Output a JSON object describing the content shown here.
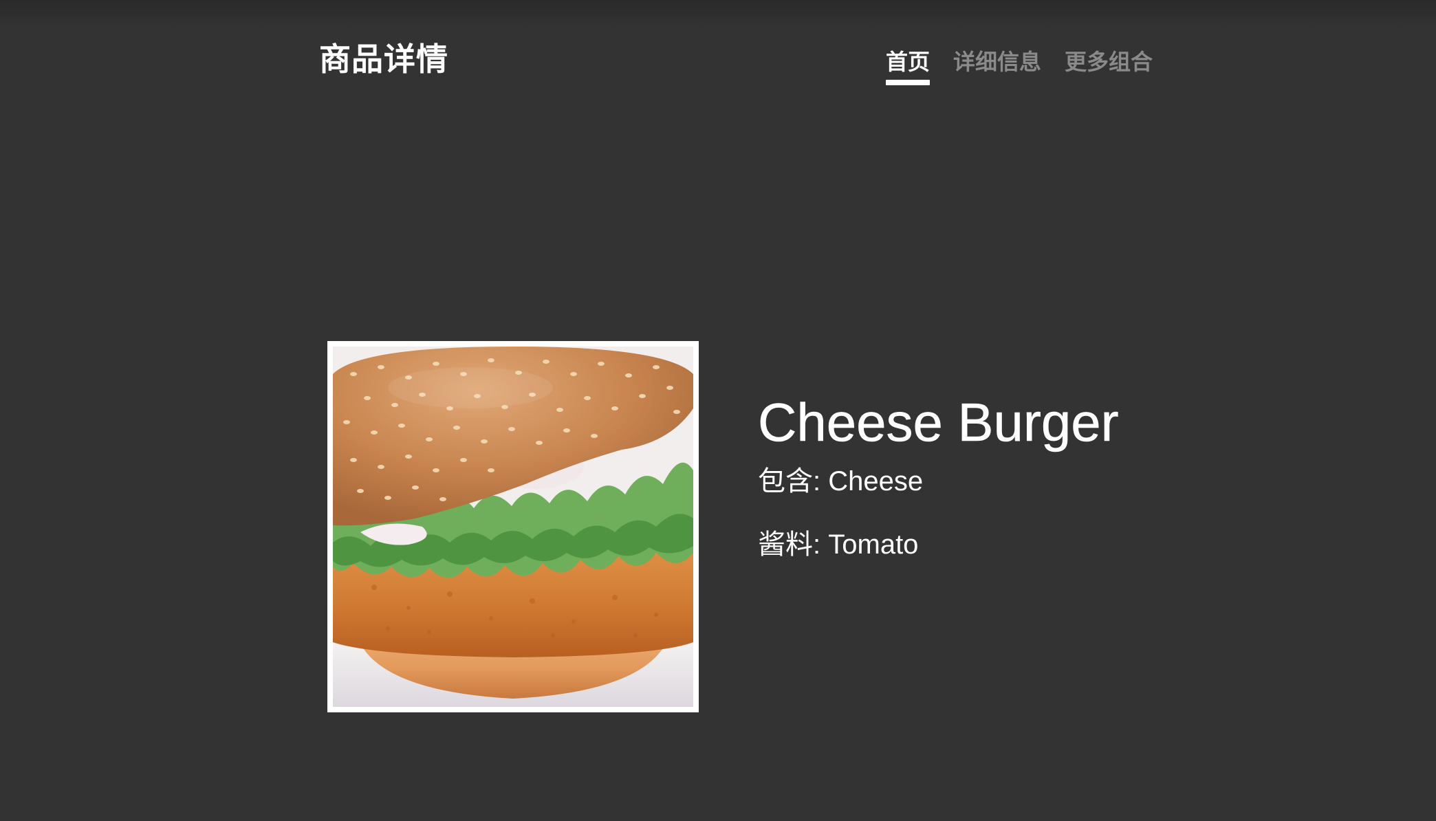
{
  "header": {
    "title": "商品详情",
    "nav": [
      {
        "label": "首页",
        "active": true
      },
      {
        "label": "详细信息",
        "active": false
      },
      {
        "label": "更多组合",
        "active": false
      }
    ]
  },
  "product": {
    "name": "Cheese Burger",
    "ingredients_label": "包含:",
    "ingredients_value": "Cheese",
    "sauce_label": "酱料:",
    "sauce_value": "Tomato",
    "image_icon": "burger-photo"
  },
  "colors": {
    "background": "#333333",
    "text": "#ffffff",
    "nav_inactive": "#8a8a8a"
  }
}
